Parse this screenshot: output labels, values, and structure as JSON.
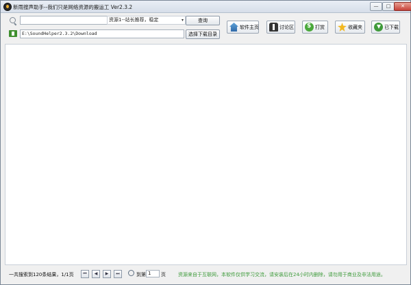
{
  "window": {
    "title": "新雨搜声助手--我们只是网络资源的搬运工 Ver2.3.2",
    "minimize_glyph": "—",
    "maximize_glyph": "□",
    "close_glyph": "✕"
  },
  "search": {
    "value": "",
    "source_selected": "资源1--站长推荐，稳定",
    "select_arrow": "▾",
    "query_label": "查询"
  },
  "download": {
    "path": "E:\\SoundHelper2.3.2\\Download",
    "choose_dir_label": "选择下载目录"
  },
  "nav": {
    "home": "软件主页",
    "forum": "讨论区",
    "tip": "打赏",
    "favorites": "收藏夹",
    "downloaded": "已下载"
  },
  "status": {
    "results_summary": "一共搜索到120条结果，1/1页",
    "first_glyph": "⏮",
    "prev_glyph": "◀",
    "next_glyph": "▶",
    "last_glyph": "⏭",
    "goto_label": "到第",
    "page_value": "1",
    "page_suffix": "页",
    "notice": "资源来自于互联网，本软件仅供学习交流，请安装后在24小时内删除，请勿用于商业及非法用途。"
  },
  "colors": {
    "notice_green": "#3d9a3a",
    "close_red": "#c6423a"
  }
}
